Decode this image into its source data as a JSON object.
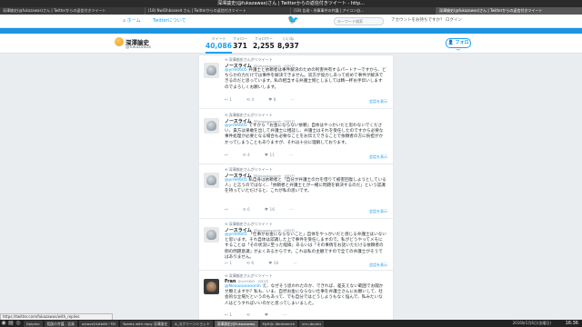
{
  "window": {
    "title": "深澤諭史(@fukazawas)さん | Twitterからの返信付きツイート - http..."
  },
  "browser_tabs": [
    {
      "label": "深澤諭史(@fukazawas)さん | Twitterからの返信付きツイート",
      "active": false
    },
    {
      "label": "(18) Nw/Dhbaseed さん | Twitterからの返信付きツイート",
      "active": false
    },
    {
      "label": "(18) 告発・刑事事件の弁護 | アイコン自...",
      "active": false
    },
    {
      "label": "深澤諭史(@fukazawas)さん | Twitterからの返信付きツイート",
      "active": true
    }
  ],
  "topnav": {
    "home_label": "ホーム",
    "about_label": "Twitterについて",
    "search_placeholder": "キーワード検索",
    "login_prompt": "アカウントをお持ちですか？ ログイン"
  },
  "profile": {
    "name": "深澤諭史",
    "handle": "@fukazawas",
    "follow_label": "フォロー",
    "stats": [
      {
        "label": "ツイート",
        "value": "40,086",
        "active": true
      },
      {
        "label": "フォロー",
        "value": "371",
        "active": false
      },
      {
        "label": "フォロワー",
        "value": "2,255",
        "active": false
      },
      {
        "label": "いいね",
        "value": "8,937",
        "active": false
      }
    ]
  },
  "tweets": [
    {
      "retweet_by": "深澤諭史さんがリツイート",
      "author": "ノースライム",
      "handle": "@Nosooooooonih · 5月5日",
      "mention": "@yn94605",
      "text": " 弁護士と依頼者は事件解決のための利害共有するパートナーですから、どちらかの力だけでは事件を解決できません。双方が協力しあって初めて事件が解決できるのだと思っています。私の相当する弁護士側としましては精一杯お手伝いしますのでよろしくお願いします。",
      "replies": "1",
      "retweets": "4",
      "likes": "8",
      "detail_label": "会話を表示"
    },
    {
      "retweet_by": "深澤諭史さんがリツイート",
      "author": "ノースライム",
      "handle": "@Nosooooooonih · 5月5日",
      "mention": "@yn94605",
      "text": " ですから「お金にならない依頼」自体はやっかいだと思わないでください。貴方は果敢を出して弁護士に相談し、弁護士はそれを受任したのですから必要な事件処理が必要となる場合も必要なことをお伝えできることで依頼者の方に負担がかかってしまうこともありますが、それは十分に理解しております。",
      "replies": "",
      "retweets": "4",
      "likes": "11",
      "detail_label": "会話を表示"
    },
    {
      "retweet_by": "深澤諭史さんがリツイート",
      "author": "ノースライム",
      "handle": "@Nosooooooonih · 5月5日",
      "mention": "@yn94605",
      "text": " 私自身は依頼者と「自分が弁護士の力を借りて被害回復しようとしている人」と言うのではなく、「依頼者と弁護士とが一緒に問題を解決するのだ」という認識を持っていただけると、これが私の思いです。",
      "replies": "",
      "retweets": "6",
      "likes": "16",
      "detail_label": "会話を表示"
    },
    {
      "retweet_by": "深澤諭史さんがリツイート",
      "author": "ノースライム",
      "handle": "@Nosooooooonih · 5月5日",
      "mention": "@yn94605",
      "text": " 「仕事がお金にならないこと」自体をやっかいだと感じる弁護士はいないと思います。それ自体は認識した上で事件を受任しますので。私がどうやってメモにすることは「その状況に至った経緯」あるいは「その事情をお話いただける依頼者の側の問題意識」がよくあるからです。これは私の主観ですので全ての弁護士がそうではありません。",
      "replies": "1",
      "retweets": "6",
      "likes": "16",
      "detail_label": "会話を表示"
    },
    {
      "retweet_by": "深澤諭史さんがリツイート",
      "author": "Fran",
      "handle": "@yn94605 · 5月5日",
      "mention": "@Nosooooooonih",
      "text": " え、なぜそう思われたのか、できれば、差支えない範囲でお聞かせ願えますか？私も、いま、自然お金にならない仕事を弁護士さんにお願いして、社会的な立場だというのもあって、でも自分ではどうしようもなく悩んで、私みたいな人はどうすればいいのかと思ってしまいました。",
      "replies": "1",
      "retweets": "",
      "likes": "",
      "detail_label": ""
    }
  ],
  "status_url": "https://twitter.com/fukazawas/with_replies",
  "taskbar": {
    "items": [
      {
        "label": "Dolphin",
        "active": false
      },
      {
        "label": "相談の弁護 - 告発",
        "active": false
      },
      {
        "label": "octave24#b80~TM",
        "active": false
      },
      {
        "label": "Tweets with reply 深澤諭史",
        "active": false
      },
      {
        "label": "A_スクリーンショット",
        "active": false
      },
      {
        "label": "深澤諭史(@fukazawas)",
        "active": true
      },
      {
        "label": "MySQL Workbench",
        "active": false
      },
      {
        "label": "vm-ubuntu",
        "active": false
      }
    ],
    "date": "2016年5月6日(金曜日)",
    "clock": "16:36"
  }
}
